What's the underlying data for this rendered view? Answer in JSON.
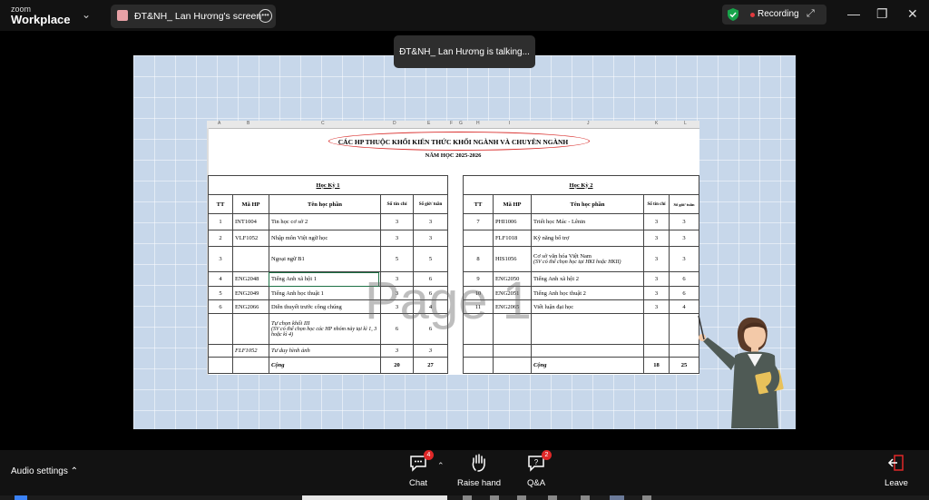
{
  "app": {
    "logo_small": "zoom",
    "logo_big": "Workplace"
  },
  "tab": {
    "title": "ĐT&NH_ Lan Hương's screen"
  },
  "recording": {
    "label": "Recording"
  },
  "notice": {
    "talking": "ĐT&NH_ Lan Hương is talking..."
  },
  "sheet": {
    "col_letters": [
      "A",
      "B",
      "C",
      "D",
      "E",
      "F",
      "G",
      "H",
      "I",
      "J",
      "K",
      "L"
    ],
    "title": "CÁC HP THUỘC KHỐI KIẾN THỨC KHỐI NGÀNH VÀ CHUYÊN NGÀNH",
    "subtitle": "NĂM HỌC 2025-2026",
    "sem1": {
      "heading": "Học Kỳ 1",
      "headers": [
        "TT",
        "Mã HP",
        "Tên học phần",
        "Số tín chỉ",
        "Số giờ/ tuần"
      ],
      "rows": [
        {
          "tt": "1",
          "code": "INT1004",
          "name": "Tin học cơ sở 2",
          "note": "",
          "credits": "3",
          "hours": "3"
        },
        {
          "tt": "2",
          "code": "VLF1052",
          "name": "Nhập môn Việt ngữ học",
          "note": "",
          "credits": "3",
          "hours": "3"
        },
        {
          "tt": "3",
          "code": "",
          "name": "Ngoại ngữ B1",
          "note": "",
          "credits": "5",
          "hours": "5"
        },
        {
          "tt": "4",
          "code": "ENG2048",
          "name": "Tiếng Anh xã hội 1",
          "note": "",
          "credits": "3",
          "hours": "6"
        },
        {
          "tt": "5",
          "code": "ENG2049",
          "name": "Tiếng Anh học thuật 1",
          "note": "",
          "credits": "3",
          "hours": "6"
        },
        {
          "tt": "6",
          "code": "ENG2066",
          "name": "Diễn thuyết trước công chúng",
          "note": "",
          "credits": "3",
          "hours": "4"
        },
        {
          "tt": "",
          "code": "",
          "name": "Tự chọn khối III",
          "note": "(SV có thể chọn học các HP nhóm này tại kì 1, 3 hoặc kì 4)",
          "credits": "6",
          "hours": "6"
        },
        {
          "tt": "",
          "code": "FLF1052",
          "name": "Tư duy hình ảnh",
          "note": "",
          "credits": "3",
          "hours": "3"
        }
      ],
      "total_label": "Cộng",
      "total_credits": "20",
      "total_hours": "27"
    },
    "sem2": {
      "heading": "Học Kỳ 2",
      "headers": [
        "TT",
        "Mã HP",
        "Tên học phần",
        "Số tín chỉ",
        "Số giờ/ tuần"
      ],
      "rows": [
        {
          "tt": "7",
          "code": "PHI1006",
          "name": "Triết học Mác - Lênin",
          "note": "",
          "credits": "3",
          "hours": "3"
        },
        {
          "tt": "",
          "code": "FLF1018",
          "name": "Kỹ năng bổ trợ",
          "note": "",
          "credits": "3",
          "hours": "3"
        },
        {
          "tt": "8",
          "code": "HIS1056",
          "name": "Cơ sở văn hóa Việt Nam",
          "note": "(SV có thể chọn học tại HKI hoặc HKII)",
          "credits": "3",
          "hours": "3"
        },
        {
          "tt": "9",
          "code": "ENG2050",
          "name": "Tiếng Anh xã hội 2",
          "note": "",
          "credits": "3",
          "hours": "6"
        },
        {
          "tt": "10",
          "code": "ENG2051",
          "name": "Tiếng Anh học thuật 2",
          "note": "",
          "credits": "3",
          "hours": "6"
        },
        {
          "tt": "11",
          "code": "ENG2065",
          "name": "Viết luận đại học",
          "note": "",
          "credits": "3",
          "hours": "4"
        }
      ],
      "total_label": "Cộng",
      "total_credits": "18",
      "total_hours": "25"
    },
    "watermark": "Page 1"
  },
  "toolbar": {
    "audio_settings": "Audio settings",
    "chat": "Chat",
    "chat_badge": "4",
    "raise_hand": "Raise hand",
    "qa": "Q&A",
    "qa_badge": "2",
    "leave": "Leave"
  },
  "colors": {
    "accent_green": "#17a34a",
    "record_red": "#e0393e",
    "badge_red": "#e02828",
    "oval_red": "#d9302e"
  }
}
